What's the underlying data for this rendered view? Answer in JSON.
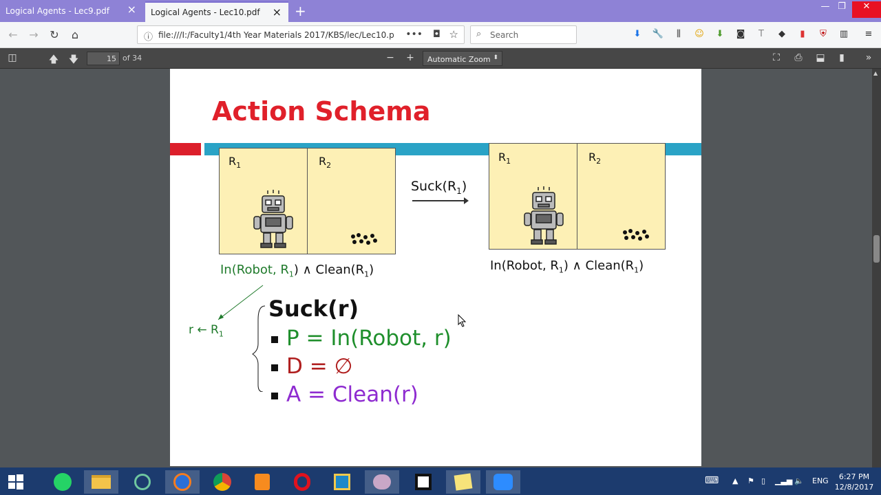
{
  "browser": {
    "tabs": [
      {
        "label": "Logical Agents - Lec9.pdf"
      },
      {
        "label": "Logical Agents - Lec10.pdf"
      }
    ],
    "url": "file:///I:/Faculty1/4th Year Materials 2017/KBS/lec/Lec10.p",
    "search_placeholder": "Search"
  },
  "pdf": {
    "page_number": "15",
    "page_count": "of 34",
    "zoom": "Automatic Zoom"
  },
  "slide": {
    "title": "Action Schema",
    "left_rooms": {
      "r1": "R",
      "r1_sub": "1",
      "r2": "R",
      "r2_sub": "2"
    },
    "right_rooms": {
      "r1": "R",
      "r1_sub": "1",
      "r2": "R",
      "r2_sub": "2"
    },
    "action_label": "Suck(R",
    "action_label_sub": "1",
    "action_label_end": ")",
    "left_state": {
      "a": "In(Robot, R",
      "a_sub": "1",
      "mid": ") ∧ Clean(R",
      "mid_sub": "1",
      "end": ")"
    },
    "right_state": {
      "a": "In(Robot, R",
      "a_sub": "1",
      "mid": ") ∧ Clean(R",
      "mid_sub": "1",
      "end": ")"
    },
    "substitution": {
      "a": "r ← R",
      "sub": "1"
    },
    "schema_title": "Suck(r)",
    "precondition": "P = In(Robot, r)",
    "delete": "D = ∅",
    "add": "A = Clean(r)"
  },
  "taskbar": {
    "language": "ENG",
    "time": "6:27 PM",
    "date": "12/8/2017"
  },
  "colors": {
    "title_red": "#e0202a",
    "accent_blue": "#2aa3c6",
    "precondition_green": "#1f8f2c",
    "delete_red": "#b01f1f",
    "add_purple": "#8e2bd0",
    "tabbar_purple": "#8e82d6"
  }
}
